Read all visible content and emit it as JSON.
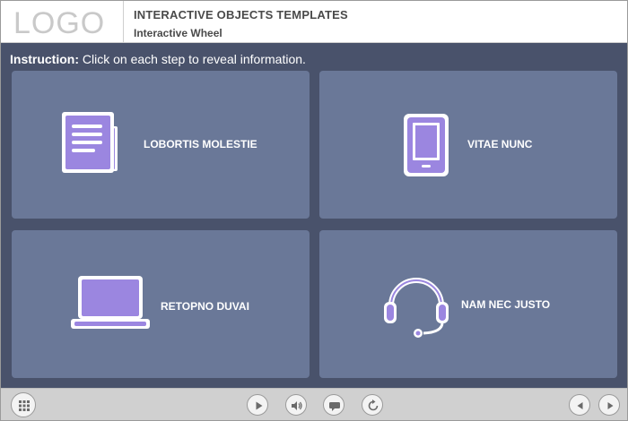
{
  "header": {
    "logo": "LOGO",
    "title": "INTERACTIVE OBJECTS TEMPLATES",
    "subtitle": "Interactive Wheel"
  },
  "instruction": {
    "label": "Instruction:",
    "text": " Click on each step to reveal information."
  },
  "cards": [
    {
      "label": "LOBORTIS MOLESTIE",
      "icon": "document-icon"
    },
    {
      "label": "VITAE NUNC",
      "icon": "tablet-icon"
    },
    {
      "label": "RETOPNO DUVAI",
      "icon": "laptop-icon"
    },
    {
      "label": "NAM NEC JUSTO",
      "icon": "headset-icon"
    }
  ],
  "footer": {
    "buttons": [
      "menu-icon",
      "play-icon",
      "volume-icon",
      "caption-icon",
      "replay-icon",
      "previous-icon",
      "next-icon"
    ]
  },
  "colors": {
    "content_bg": "#49526b",
    "card_bg": "#6a7898",
    "icon_fill": "#9b86e0",
    "icon_outline": "#ffffff"
  }
}
